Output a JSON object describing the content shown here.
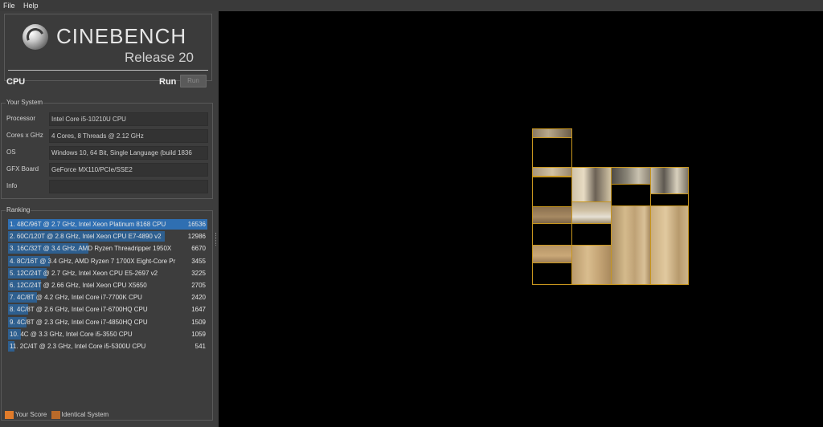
{
  "menu": {
    "items": [
      "File",
      "Help"
    ]
  },
  "header": {
    "app_name": "CINEBENCH",
    "release": "Release 20",
    "mode_label": "CPU",
    "run_label": "Run",
    "run_button_label": "Run"
  },
  "your_system": {
    "title": "Your System",
    "rows": [
      {
        "label": "Processor",
        "value": "Intel Core i5-10210U CPU"
      },
      {
        "label": "Cores x GHz",
        "value": "4 Cores, 8 Threads @ 2.12 GHz"
      },
      {
        "label": "OS",
        "value": "Windows 10, 64 Bit, Single Language (build 1836"
      },
      {
        "label": "GFX Board",
        "value": "GeForce MX110/PCIe/SSE2"
      },
      {
        "label": "Info",
        "value": ""
      }
    ]
  },
  "ranking": {
    "title": "Ranking",
    "max_score": 16536,
    "entries": [
      {
        "name": "1. 48C/96T @ 2.7 GHz, Intel Xeon Platinum 8168 CPU",
        "score": 16536,
        "highlight": true
      },
      {
        "name": "2. 60C/120T @ 2.8 GHz, Intel Xeon CPU E7-4890 v2",
        "score": 12986,
        "highlight": false
      },
      {
        "name": "3. 16C/32T @ 3.4 GHz, AMD Ryzen Threadripper 1950X",
        "score": 6670,
        "highlight": false
      },
      {
        "name": "4. 8C/16T @ 3.4 GHz, AMD Ryzen 7 1700X Eight-Core Pr",
        "score": 3455,
        "highlight": false
      },
      {
        "name": "5. 12C/24T @ 2.7 GHz, Intel Xeon CPU E5-2697 v2",
        "score": 3225,
        "highlight": false
      },
      {
        "name": "6. 12C/24T @ 2.66 GHz, Intel Xeon CPU X5650",
        "score": 2705,
        "highlight": false
      },
      {
        "name": "7. 4C/8T @ 4.2 GHz, Intel Core i7-7700K CPU",
        "score": 2420,
        "highlight": false
      },
      {
        "name": "8. 4C/8T @ 2.6 GHz, Intel Core i7-6700HQ CPU",
        "score": 1647,
        "highlight": false
      },
      {
        "name": "9. 4C/8T @ 2.3 GHz, Intel Core i7-4850HQ CPU",
        "score": 1509,
        "highlight": false
      },
      {
        "name": "10. 4C @ 3.3 GHz, Intel Core i5-3550 CPU",
        "score": 1059,
        "highlight": false
      },
      {
        "name": "11. 2C/4T @ 2.3 GHz, Intel Core i5-5300U CPU",
        "score": 541,
        "highlight": false
      }
    ]
  },
  "legend": {
    "your_score": "Your Score",
    "identical_system": "Identical System",
    "your_score_color": "#e07b2a",
    "identical_color": "#b86a2a"
  },
  "colors": {
    "bar": "#2e5f8f",
    "bar_highlight": "#2f6fb2",
    "tile_border": "#c8961e"
  },
  "render": {
    "icon": "render-viewport"
  }
}
